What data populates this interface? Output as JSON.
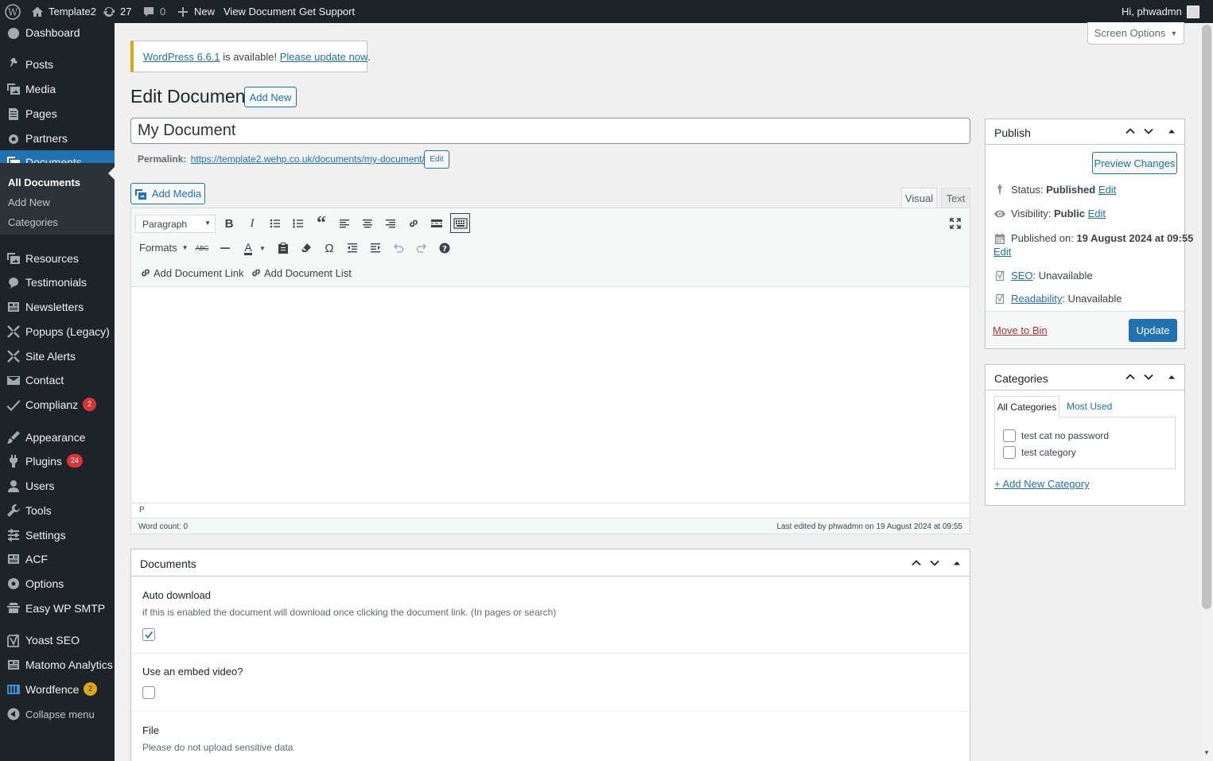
{
  "admin_bar": {
    "site_name": "Template2",
    "updates_count": "27",
    "comments_count": "0",
    "new_label": "New",
    "view_label": "View Document",
    "support_label": "Get Support",
    "greeting": "Hi, phwadmn"
  },
  "sidebar": {
    "items": [
      {
        "label": "Dashboard",
        "icon": "dashboard-icon"
      },
      {
        "label": "Posts",
        "icon": "pin-icon"
      },
      {
        "label": "Media",
        "icon": "media-icon"
      },
      {
        "label": "Pages",
        "icon": "pages-icon"
      },
      {
        "label": "Partners",
        "icon": "partners-icon"
      },
      {
        "label": "Documents",
        "icon": "documents-icon",
        "current": true
      },
      {
        "label": "Resources",
        "icon": "resources-icon"
      },
      {
        "label": "Testimonials",
        "icon": "testimonials-icon"
      },
      {
        "label": "Newsletters",
        "icon": "newsletters-icon"
      },
      {
        "label": "Popups (Legacy)",
        "icon": "popups-icon"
      },
      {
        "label": "Site Alerts",
        "icon": "site-alerts-icon"
      },
      {
        "label": "Contact",
        "icon": "contact-icon"
      },
      {
        "label": "Complianz",
        "icon": "complianz-icon",
        "badge": "2"
      },
      {
        "label": "Appearance",
        "icon": "appearance-icon"
      },
      {
        "label": "Plugins",
        "icon": "plugins-icon",
        "badge": "24"
      },
      {
        "label": "Users",
        "icon": "users-icon"
      },
      {
        "label": "Tools",
        "icon": "tools-icon"
      },
      {
        "label": "Settings",
        "icon": "settings-icon"
      },
      {
        "label": "ACF",
        "icon": "acf-icon"
      },
      {
        "label": "Options",
        "icon": "options-icon"
      },
      {
        "label": "Easy WP SMTP",
        "icon": "smtp-icon"
      },
      {
        "label": "Yoast SEO",
        "icon": "yoast-icon"
      },
      {
        "label": "Matomo Analytics",
        "icon": "matomo-icon"
      },
      {
        "label": "Wordfence",
        "icon": "wordfence-icon",
        "badge": "2"
      },
      {
        "label": "Collapse menu",
        "icon": "collapse-icon"
      }
    ],
    "submenu": [
      "All Documents",
      "Add New",
      "Categories"
    ]
  },
  "screen_options": "Screen Options",
  "notice": {
    "link1": "WordPress 6.6.1",
    "text": " is available! ",
    "link2": "Please update now",
    "end": "."
  },
  "page_title": "Edit Document",
  "add_new": "Add New",
  "post_title": "My Document",
  "permalink": {
    "label": "Permalink:",
    "url": "https://template2.wehp.co.uk/documents/my-document/",
    "edit": "Edit"
  },
  "editor": {
    "add_media": "Add Media",
    "tab_visual": "Visual",
    "tab_text": "Text",
    "format_select": "Paragraph",
    "formats_label": "Formats",
    "add_document_link": "Add Document Link",
    "add_document_list": "Add Document List",
    "path": "P",
    "word_count": "Word count: 0",
    "last_edited": "Last edited by phwadmn on 19 August 2024 at 09:55"
  },
  "documents_box": {
    "title": "Documents",
    "auto_download_label": "Auto download",
    "auto_download_desc": "if this is enabled the document will download once clicking the document link. (In pages or search)",
    "auto_download_checked": true,
    "embed_label": "Use an embed video?",
    "embed_checked": false,
    "file_label": "File",
    "file_desc": "Please do not upload sensitive data"
  },
  "publish": {
    "title": "Publish",
    "preview": "Preview Changes",
    "status_label": "Status:",
    "status_value": "Published",
    "visibility_label": "Visibility:",
    "visibility_value": "Public",
    "published_label": "Published on:",
    "published_value": "19 August 2024 at 09:55",
    "edit": "Edit",
    "seo_link": "SEO",
    "seo_value": ": Unavailable",
    "readability_link": "Readability",
    "readability_value": ": Unavailable",
    "move_to_bin": "Move to Bin",
    "update": "Update"
  },
  "categories": {
    "title": "Categories",
    "tab_all": "All Categories",
    "tab_most": "Most Used",
    "items": [
      "test cat no password",
      "test category"
    ],
    "add_new": "+ Add New Category"
  },
  "colors": {
    "accent": "#2271b1",
    "admin_bar": "#1d2327",
    "badge_red": "#d63638",
    "badge_yellow": "#dba617",
    "link_red": "#b32d2e"
  }
}
